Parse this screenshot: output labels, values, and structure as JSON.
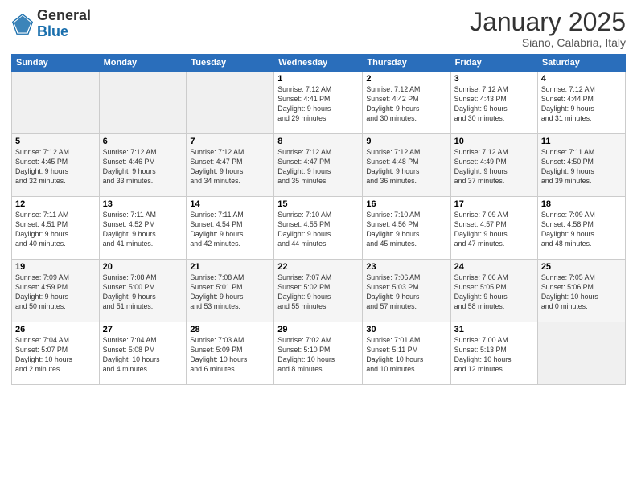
{
  "logo": {
    "general": "General",
    "blue": "Blue"
  },
  "header": {
    "month": "January 2025",
    "location": "Siano, Calabria, Italy"
  },
  "weekdays": [
    "Sunday",
    "Monday",
    "Tuesday",
    "Wednesday",
    "Thursday",
    "Friday",
    "Saturday"
  ],
  "weeks": [
    [
      {
        "day": "",
        "info": ""
      },
      {
        "day": "",
        "info": ""
      },
      {
        "day": "",
        "info": ""
      },
      {
        "day": "1",
        "info": "Sunrise: 7:12 AM\nSunset: 4:41 PM\nDaylight: 9 hours\nand 29 minutes."
      },
      {
        "day": "2",
        "info": "Sunrise: 7:12 AM\nSunset: 4:42 PM\nDaylight: 9 hours\nand 30 minutes."
      },
      {
        "day": "3",
        "info": "Sunrise: 7:12 AM\nSunset: 4:43 PM\nDaylight: 9 hours\nand 30 minutes."
      },
      {
        "day": "4",
        "info": "Sunrise: 7:12 AM\nSunset: 4:44 PM\nDaylight: 9 hours\nand 31 minutes."
      }
    ],
    [
      {
        "day": "5",
        "info": "Sunrise: 7:12 AM\nSunset: 4:45 PM\nDaylight: 9 hours\nand 32 minutes."
      },
      {
        "day": "6",
        "info": "Sunrise: 7:12 AM\nSunset: 4:46 PM\nDaylight: 9 hours\nand 33 minutes."
      },
      {
        "day": "7",
        "info": "Sunrise: 7:12 AM\nSunset: 4:47 PM\nDaylight: 9 hours\nand 34 minutes."
      },
      {
        "day": "8",
        "info": "Sunrise: 7:12 AM\nSunset: 4:47 PM\nDaylight: 9 hours\nand 35 minutes."
      },
      {
        "day": "9",
        "info": "Sunrise: 7:12 AM\nSunset: 4:48 PM\nDaylight: 9 hours\nand 36 minutes."
      },
      {
        "day": "10",
        "info": "Sunrise: 7:12 AM\nSunset: 4:49 PM\nDaylight: 9 hours\nand 37 minutes."
      },
      {
        "day": "11",
        "info": "Sunrise: 7:11 AM\nSunset: 4:50 PM\nDaylight: 9 hours\nand 39 minutes."
      }
    ],
    [
      {
        "day": "12",
        "info": "Sunrise: 7:11 AM\nSunset: 4:51 PM\nDaylight: 9 hours\nand 40 minutes."
      },
      {
        "day": "13",
        "info": "Sunrise: 7:11 AM\nSunset: 4:52 PM\nDaylight: 9 hours\nand 41 minutes."
      },
      {
        "day": "14",
        "info": "Sunrise: 7:11 AM\nSunset: 4:54 PM\nDaylight: 9 hours\nand 42 minutes."
      },
      {
        "day": "15",
        "info": "Sunrise: 7:10 AM\nSunset: 4:55 PM\nDaylight: 9 hours\nand 44 minutes."
      },
      {
        "day": "16",
        "info": "Sunrise: 7:10 AM\nSunset: 4:56 PM\nDaylight: 9 hours\nand 45 minutes."
      },
      {
        "day": "17",
        "info": "Sunrise: 7:09 AM\nSunset: 4:57 PM\nDaylight: 9 hours\nand 47 minutes."
      },
      {
        "day": "18",
        "info": "Sunrise: 7:09 AM\nSunset: 4:58 PM\nDaylight: 9 hours\nand 48 minutes."
      }
    ],
    [
      {
        "day": "19",
        "info": "Sunrise: 7:09 AM\nSunset: 4:59 PM\nDaylight: 9 hours\nand 50 minutes."
      },
      {
        "day": "20",
        "info": "Sunrise: 7:08 AM\nSunset: 5:00 PM\nDaylight: 9 hours\nand 51 minutes."
      },
      {
        "day": "21",
        "info": "Sunrise: 7:08 AM\nSunset: 5:01 PM\nDaylight: 9 hours\nand 53 minutes."
      },
      {
        "day": "22",
        "info": "Sunrise: 7:07 AM\nSunset: 5:02 PM\nDaylight: 9 hours\nand 55 minutes."
      },
      {
        "day": "23",
        "info": "Sunrise: 7:06 AM\nSunset: 5:03 PM\nDaylight: 9 hours\nand 57 minutes."
      },
      {
        "day": "24",
        "info": "Sunrise: 7:06 AM\nSunset: 5:05 PM\nDaylight: 9 hours\nand 58 minutes."
      },
      {
        "day": "25",
        "info": "Sunrise: 7:05 AM\nSunset: 5:06 PM\nDaylight: 10 hours\nand 0 minutes."
      }
    ],
    [
      {
        "day": "26",
        "info": "Sunrise: 7:04 AM\nSunset: 5:07 PM\nDaylight: 10 hours\nand 2 minutes."
      },
      {
        "day": "27",
        "info": "Sunrise: 7:04 AM\nSunset: 5:08 PM\nDaylight: 10 hours\nand 4 minutes."
      },
      {
        "day": "28",
        "info": "Sunrise: 7:03 AM\nSunset: 5:09 PM\nDaylight: 10 hours\nand 6 minutes."
      },
      {
        "day": "29",
        "info": "Sunrise: 7:02 AM\nSunset: 5:10 PM\nDaylight: 10 hours\nand 8 minutes."
      },
      {
        "day": "30",
        "info": "Sunrise: 7:01 AM\nSunset: 5:11 PM\nDaylight: 10 hours\nand 10 minutes."
      },
      {
        "day": "31",
        "info": "Sunrise: 7:00 AM\nSunset: 5:13 PM\nDaylight: 10 hours\nand 12 minutes."
      },
      {
        "day": "",
        "info": ""
      }
    ]
  ]
}
